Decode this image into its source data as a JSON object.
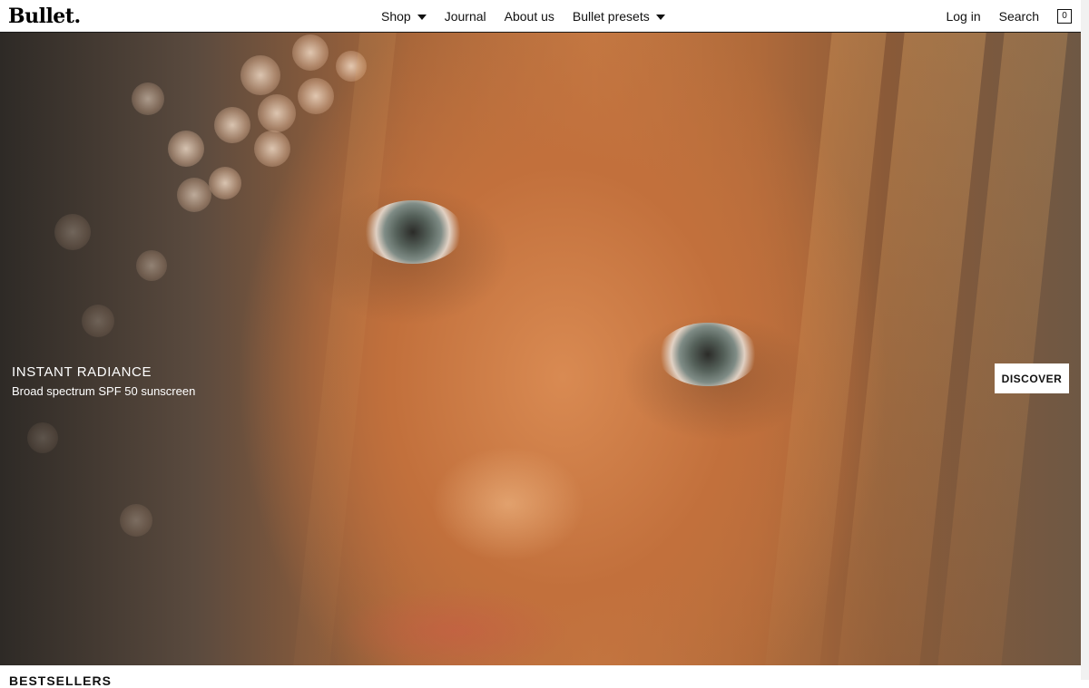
{
  "header": {
    "logo_text": "Bullet.",
    "nav": [
      {
        "label": "Shop",
        "has_dropdown": true
      },
      {
        "label": "Journal",
        "has_dropdown": false
      },
      {
        "label": "About us",
        "has_dropdown": false
      },
      {
        "label": "Bullet presets",
        "has_dropdown": true
      }
    ],
    "login_label": "Log in",
    "search_label": "Search",
    "cart_count": "0"
  },
  "hero": {
    "title": "INSTANT RADIANCE",
    "subtitle": "Broad spectrum SPF 50 sunscreen",
    "cta_label": "DISCOVER"
  },
  "section": {
    "heading": "BESTSELLERS"
  },
  "colors": {
    "header_bg": "#ffffff",
    "text": "#111111",
    "button_bg": "#ffffff",
    "hero_text": "#ffffff"
  }
}
